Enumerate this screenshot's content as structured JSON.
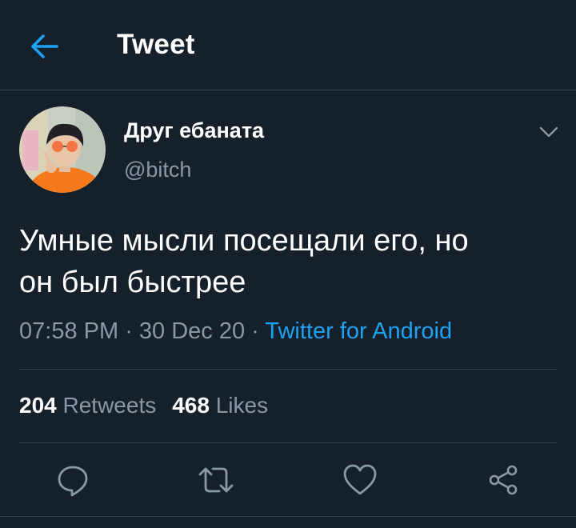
{
  "header": {
    "back_icon": "arrow-left-icon",
    "title": "Tweet"
  },
  "tweet": {
    "author": {
      "name": "Друг ебаната",
      "handle": "@bitch",
      "avatar": "avatar-photo"
    },
    "text_line1": "Умные мысли посещали его, но",
    "text_line2": "он был быстрее",
    "time": "07:58 PM",
    "sep1": " · ",
    "date": "30 Dec 20",
    "sep2": " · ",
    "source": "Twitter for Android",
    "retweets_count": "204",
    "retweets_label": "Retweets",
    "likes_count": "468",
    "likes_label": "Likes"
  },
  "actions": [
    {
      "icon": "reply-icon"
    },
    {
      "icon": "retweet-icon"
    },
    {
      "icon": "like-heart-icon"
    },
    {
      "icon": "share-icon"
    }
  ],
  "colors": {
    "background": "#15202b",
    "accent": "#1da1f2",
    "secondary_text": "#8899a6",
    "divider": "#38444d"
  }
}
